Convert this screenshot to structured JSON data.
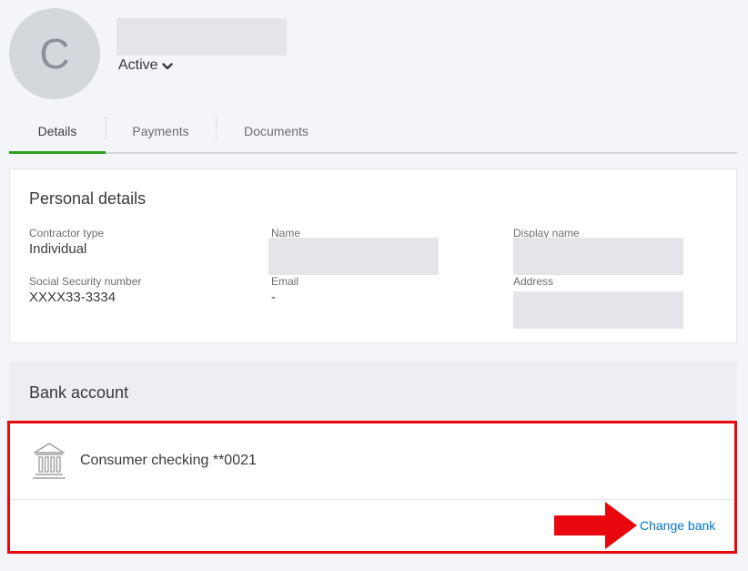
{
  "profile": {
    "avatar_initial": "C",
    "status": "Active",
    "status_icon": "chevron-down-icon"
  },
  "tabs": [
    {
      "label": "Details",
      "active": true
    },
    {
      "label": "Payments",
      "active": false
    },
    {
      "label": "Documents",
      "active": false
    }
  ],
  "personal_details": {
    "title": "Personal details",
    "contractor_type_label": "Contractor type",
    "contractor_type_value": "Individual",
    "ssn_label": "Social Security number",
    "ssn_value": "XXXX33-3334",
    "name_label": "Name",
    "email_label": "Email",
    "email_value": "-",
    "display_name_label": "Display name",
    "address_label": "Address"
  },
  "bank_account": {
    "title": "Bank account",
    "account_name": "Consumer checking **0021",
    "bank_icon": "bank-icon",
    "change_bank_label": "Change bank"
  },
  "colors": {
    "accent_green": "#2ca01c",
    "link_blue": "#0077c5",
    "highlight_red": "#e8060f"
  }
}
